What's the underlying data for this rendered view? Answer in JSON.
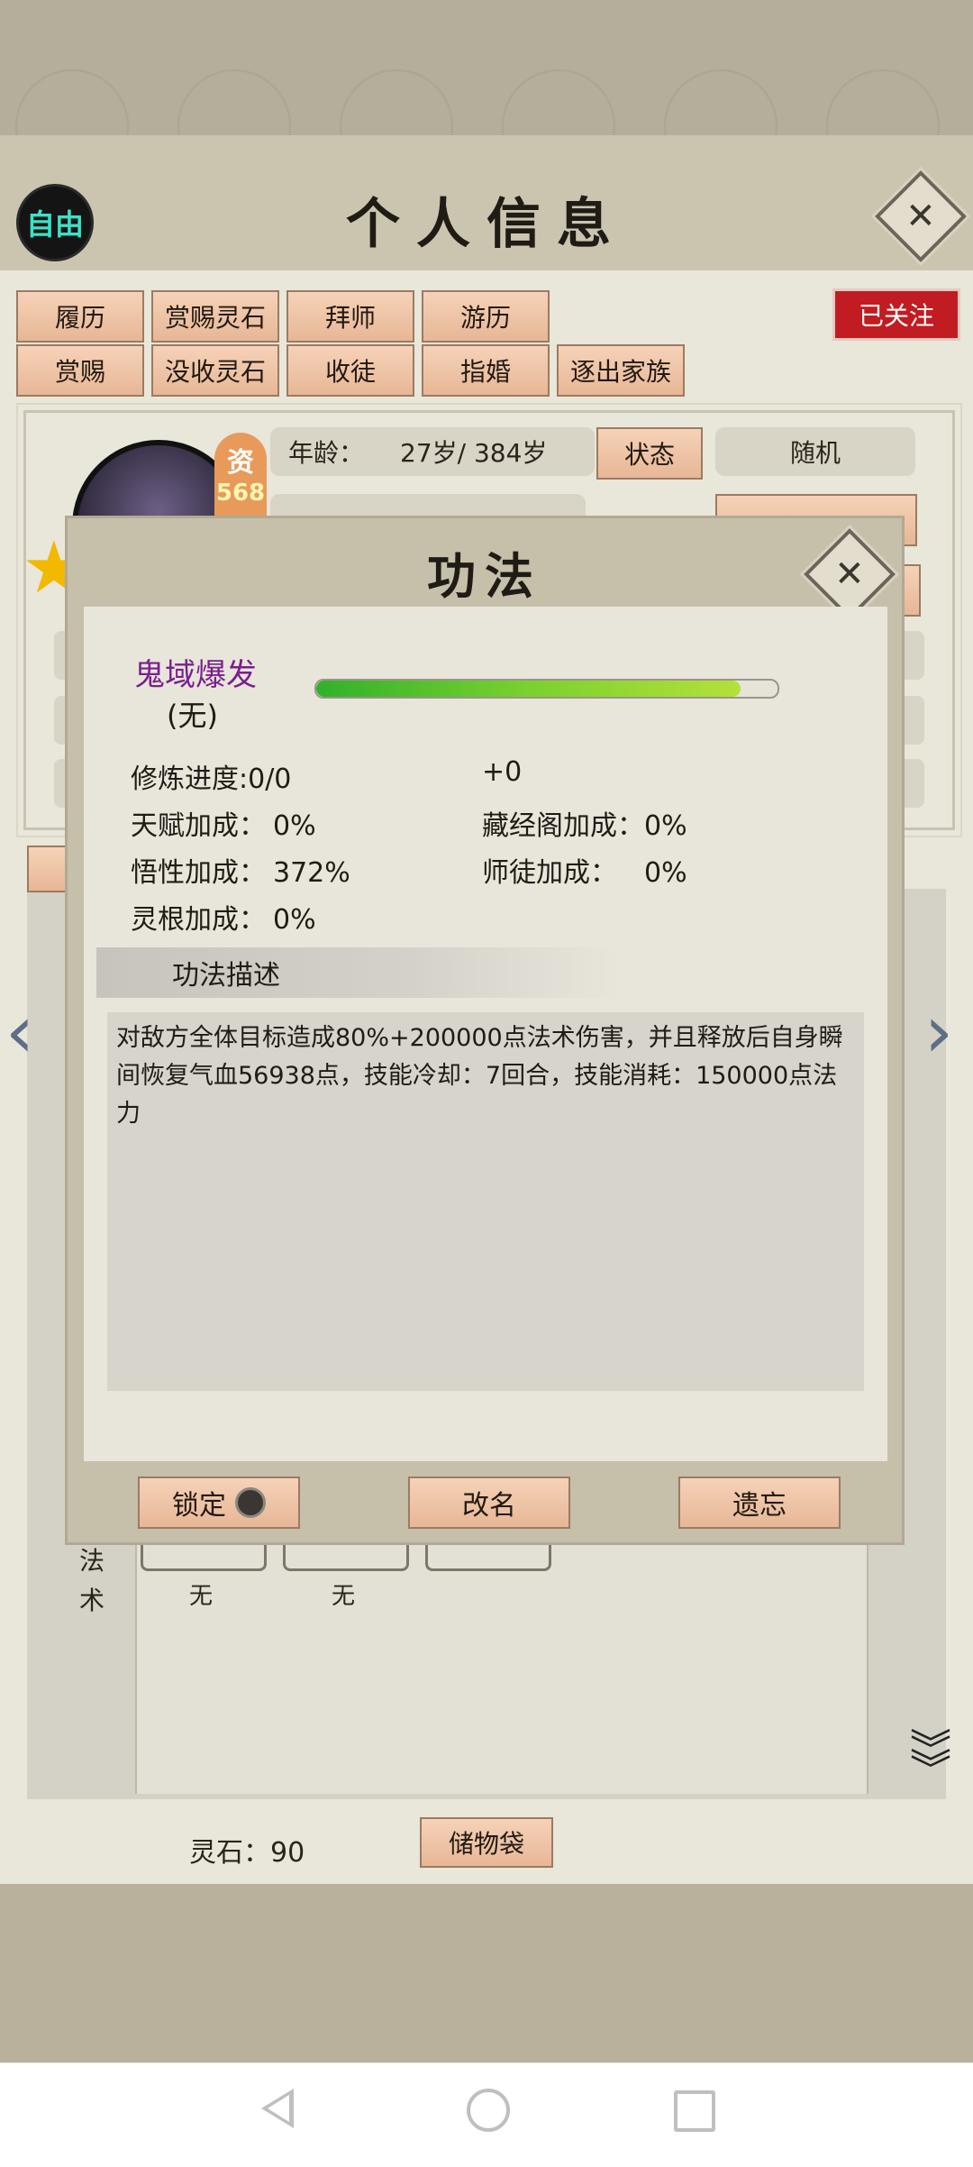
{
  "header": {
    "title": "个人信息",
    "status_badge": "自由"
  },
  "action_buttons": {
    "row1": [
      "履历",
      "赏赐灵石",
      "拜师",
      "游历"
    ],
    "row2": [
      "赏赐",
      "没收灵石",
      "收徒",
      "指婚",
      "逐出家族"
    ],
    "follow_badge": "已关注"
  },
  "profile": {
    "qualification_char": "资",
    "qualification_value": "568",
    "age_label": "年龄：",
    "age_value": "27岁/ 384岁",
    "state_button": "状态",
    "state_value": "随机"
  },
  "modal": {
    "title": "功法",
    "skill_name": "鬼域爆发",
    "skill_status": "(无)",
    "progress_fraction": 0.92,
    "stats": {
      "training_progress": "修炼进度:0/0",
      "training_bonus": "+0",
      "talent_label": "天赋加成：",
      "talent_value": "0%",
      "library_label": "藏经阁加成：",
      "library_value": "0%",
      "comprehension_label": "悟性加成：",
      "comprehension_value": "372%",
      "mentor_label": "师徒加成：",
      "mentor_value": "0%",
      "spirit_root_label": "灵根加成：",
      "spirit_root_value": "0%"
    },
    "desc_header": "功法描述",
    "description": "对敌方全体目标造成80%+200000点法术伤害，并且释放后自身瞬间恢复气血56938点，技能冷却：7回合，技能消耗：150000点法力",
    "buttons": {
      "lock": "锁定",
      "rename": "改名",
      "forget": "遗忘"
    }
  },
  "lower": {
    "section_label": "法术",
    "slot_labels": [
      "无",
      "无"
    ],
    "spirit_stone": "灵石：90",
    "storage_button": "储物袋"
  }
}
